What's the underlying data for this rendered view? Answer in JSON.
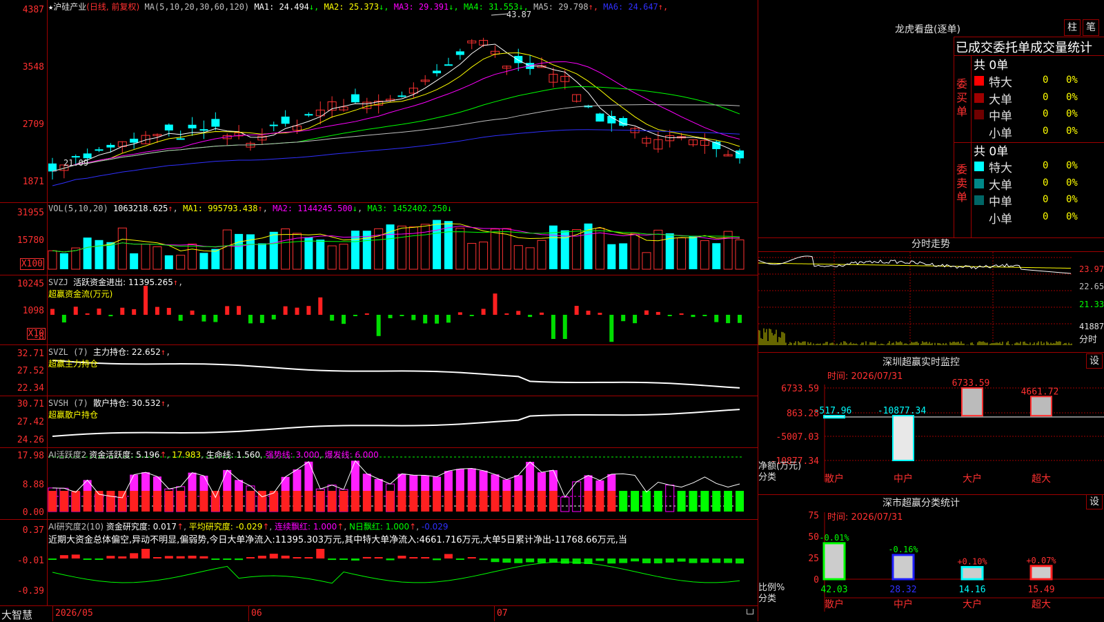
{
  "main": {
    "star": "★",
    "name": "沪硅产业",
    "period": "(日线, 前复权)",
    "ma_label": "MA(5,10,20,30,60,120)",
    "ma": [
      {
        "t": "MA1: 24.494",
        "a": "↓",
        "c": "#ffffff"
      },
      {
        "t": "MA2: 25.373",
        "a": "↓",
        "c": "#ffff00"
      },
      {
        "t": "MA3: 29.391",
        "a": "↓",
        "c": "#ff00ff"
      },
      {
        "t": "MA4: 31.553",
        "a": "↓",
        "c": "#00ff00"
      },
      {
        "t": "MA5: 29.798",
        "a": "↑",
        "c": "#c0c0c0"
      },
      {
        "t": "MA6: 24.647",
        "a": "↑",
        "c": "#3030ff"
      }
    ],
    "yticks": [
      "4387",
      "3548",
      "2709",
      "1871"
    ],
    "high_label": "43.87",
    "low_label": "21.09"
  },
  "vol": {
    "header": "VOL(5,10,20)",
    "value": "1063218.625",
    "ma1": "MA1: 995793.438",
    "ma2": "MA2: 1144245.500",
    "ma3": "MA3: 1452402.250",
    "yticks": [
      "31955",
      "15780"
    ],
    "unit": "X100"
  },
  "svzj": {
    "header": "SVZJ",
    "label": "活跃资金进出: 11395.265",
    "sub": "超赢资金流(万元)",
    "yticks": [
      "10245",
      "1098",
      "-8"
    ],
    "unit": "X10"
  },
  "svzl": {
    "header": "SVZL (7)",
    "label": "主力持仓: 22.652",
    "sub": "超赢主力持仓",
    "yticks": [
      "32.71",
      "27.52",
      "22.34"
    ]
  },
  "svsh": {
    "header": "SVSH (7)",
    "label": "散户持仓: 30.532",
    "sub": "超赢散户持仓",
    "yticks": [
      "30.71",
      "27.42",
      "24.26"
    ]
  },
  "ai1": {
    "header": "AI活跃度2",
    "label": "资金活跃度: 5.196",
    "v2": "17.983",
    "v3": "生命线: 1.560",
    "v4": "强势线: 3.000",
    "v5": "爆发线: 6.000",
    "yticks": [
      "17.98",
      "8.88",
      "0.00"
    ]
  },
  "ai2": {
    "header": "AI研究度2(10)",
    "label": "资金研究度: 0.017",
    "v2": "平均研究度: -0.029",
    "v3": "连续飘红: 1.000",
    "v4": "N日飘红: 1.000",
    "v5": "-0.029",
    "desc": "近期大资金总体偏空,异动不明显,偏弱势,今日大单净流入:11395.303万元,其中特大单净流入:4661.716万元,大单5日累计净出-11768.66万元,当",
    "yticks": [
      "0.37",
      "-0.01",
      "-0.39"
    ]
  },
  "bottom": {
    "brand": "大智慧",
    "dates": [
      "2026/05",
      "06",
      "07"
    ]
  },
  "right": {
    "lhb_title": "龙虎看盘(逐单)",
    "btn_zhu": "柱",
    "btn_bi": "笔",
    "stats_title": "已成交委托单成交量统计",
    "buy_label": "委买单",
    "sell_label": "委卖单",
    "buy_total": "共 0单",
    "sell_total": "共 0单",
    "buy_rows": [
      {
        "name": "特大",
        "v": "0",
        "p": "0%",
        "c": "#ff0000"
      },
      {
        "name": "大单",
        "v": "0",
        "p": "0%",
        "c": "#a00000"
      },
      {
        "name": "中单",
        "v": "0",
        "p": "0%",
        "c": "#700000"
      },
      {
        "name": "小单",
        "v": "0",
        "p": "0%",
        "c": "#000000"
      }
    ],
    "sell_rows": [
      {
        "name": "特大",
        "v": "0",
        "p": "0%",
        "c": "#00ffff"
      },
      {
        "name": "大单",
        "v": "0",
        "p": "0%",
        "c": "#008888"
      },
      {
        "name": "中单",
        "v": "0",
        "p": "0%",
        "c": "#006666"
      },
      {
        "name": "小单",
        "v": "0",
        "p": "0%",
        "c": "#000000"
      }
    ],
    "intraday_title": "分时走势",
    "intraday_y": [
      "23.97",
      "22.65",
      "21.33",
      "41887",
      "分时"
    ],
    "sz_title": "深圳超赢实时监控",
    "sz_btn": "设",
    "sz_time": "时间: 2026/07/31",
    "sz_yticks": [
      "6733.59",
      "863.28",
      "-5007.03",
      "-10877.34"
    ],
    "sz_unit": "净额(万元)",
    "sz_cat": "分类",
    "sz_bars": [
      {
        "name": "散户",
        "value": -517.96,
        "label": "-517.96",
        "lc": "#00ffff"
      },
      {
        "name": "中户",
        "value": -10877.34,
        "label": "-10877.34",
        "lc": "#00ffff"
      },
      {
        "name": "大户",
        "value": 6733.59,
        "label": "6733.59",
        "lc": "#ff3030"
      },
      {
        "name": "超大",
        "value": 4661.72,
        "label": "4661.72",
        "lc": "#ff3030"
      }
    ],
    "cls_title": "深市超赢分类统计",
    "cls_btn": "设",
    "cls_time": "时间: 2026/07/31",
    "cls_yticks": [
      "75",
      "50",
      "25",
      "0"
    ],
    "cls_unit": "比例%",
    "cls_cat": "分类",
    "cls_bars": [
      {
        "name": "散户",
        "value": 42.03,
        "label": "42.03",
        "chg": "-0.01%",
        "chgc": "#00ff00",
        "fill": "#00ff00"
      },
      {
        "name": "中户",
        "value": 28.32,
        "label": "28.32",
        "chg": "-0.16%",
        "chgc": "#00ff00",
        "fill": "#2020ff"
      },
      {
        "name": "大户",
        "value": 14.16,
        "label": "14.16",
        "chg": "+0.10%",
        "chgc": "#ff3030",
        "fill": "#00ffff"
      },
      {
        "name": "超大",
        "value": 15.49,
        "label": "15.49",
        "chg": "+0.07%",
        "chgc": "#ff3030",
        "fill": "#ff2020"
      }
    ]
  },
  "colors": {
    "up": "#ff3232",
    "down": "#00ffff",
    "axis": "#a00000",
    "ma1": "#ffffff",
    "ma2": "#ffff00",
    "ma3": "#ff00ff",
    "ma4": "#00ff00",
    "ma5": "#c0c0c0",
    "ma6": "#3030ff"
  }
}
